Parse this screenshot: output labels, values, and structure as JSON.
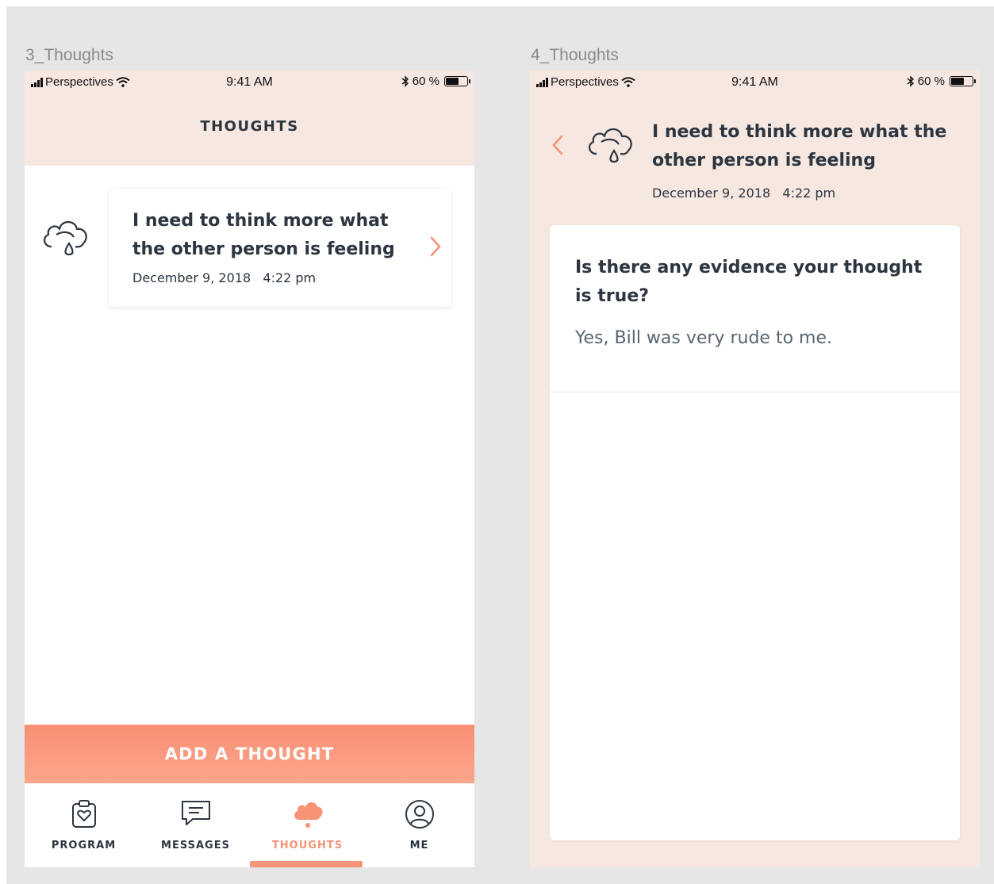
{
  "artboards": [
    {
      "label": "3_Thoughts"
    },
    {
      "label": "4_Thoughts"
    }
  ],
  "status_bar": {
    "carrier": "Perspectives",
    "time": "9:41 AM",
    "battery_text": "60 %",
    "battery_level": 0.6
  },
  "screen1": {
    "header_title": "THOUGHTS",
    "thought_card": {
      "icon": "cloud-rain-icon",
      "title": "I need to think more what the other person is feeling",
      "date": "December 9, 2018   4:22 pm"
    },
    "add_button_label": "ADD A THOUGHT",
    "tabs": [
      {
        "label": "PROGRAM",
        "icon": "clipboard-heart-icon",
        "active": false
      },
      {
        "label": "MESSAGES",
        "icon": "message-icon",
        "active": false
      },
      {
        "label": "THOUGHTS",
        "icon": "cloud-icon",
        "active": true
      },
      {
        "label": "ME",
        "icon": "user-icon",
        "active": false
      }
    ]
  },
  "screen2": {
    "title": "I need to think more what the other person is feeling",
    "date": "December 9, 2018   4:22 pm",
    "question": "Is there any evidence your thought is true?",
    "answer": "Yes, Bill was very rude to me."
  },
  "colors": {
    "accent": "#f79376",
    "header_bg": "#f6e7e0",
    "text_dark": "#2c3540",
    "canvas_bg": "#e6e6e6"
  }
}
